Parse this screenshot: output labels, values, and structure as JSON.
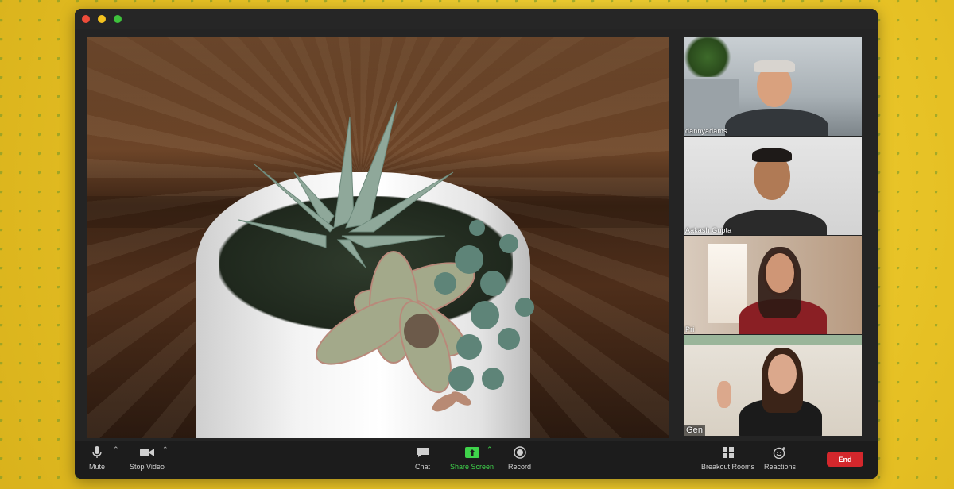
{
  "window": {
    "controls": [
      "close",
      "minimize",
      "maximize"
    ]
  },
  "participants": [
    {
      "name": "dannyadams"
    },
    {
      "name": "Aakash Gupta"
    },
    {
      "name": "Pri"
    },
    {
      "name": "Gen"
    }
  ],
  "toolbar": {
    "mute": {
      "label": "Mute",
      "icon": "microphone-icon"
    },
    "stop_video": {
      "label": "Stop Video",
      "icon": "video-camera-icon"
    },
    "chat": {
      "label": "Chat",
      "icon": "chat-bubble-icon"
    },
    "share_screen": {
      "label": "Share Screen",
      "icon": "share-screen-icon"
    },
    "record": {
      "label": "Record",
      "icon": "record-icon"
    },
    "breakout_rooms": {
      "label": "Breakout Rooms",
      "icon": "grid-icon"
    },
    "reactions": {
      "label": "Reactions",
      "icon": "emoji-icon"
    },
    "end": {
      "label": "End"
    }
  },
  "colors": {
    "toolbar_bg": "#1c1c1c",
    "share_green": "#3fd34b",
    "end_red": "#d4272c"
  }
}
